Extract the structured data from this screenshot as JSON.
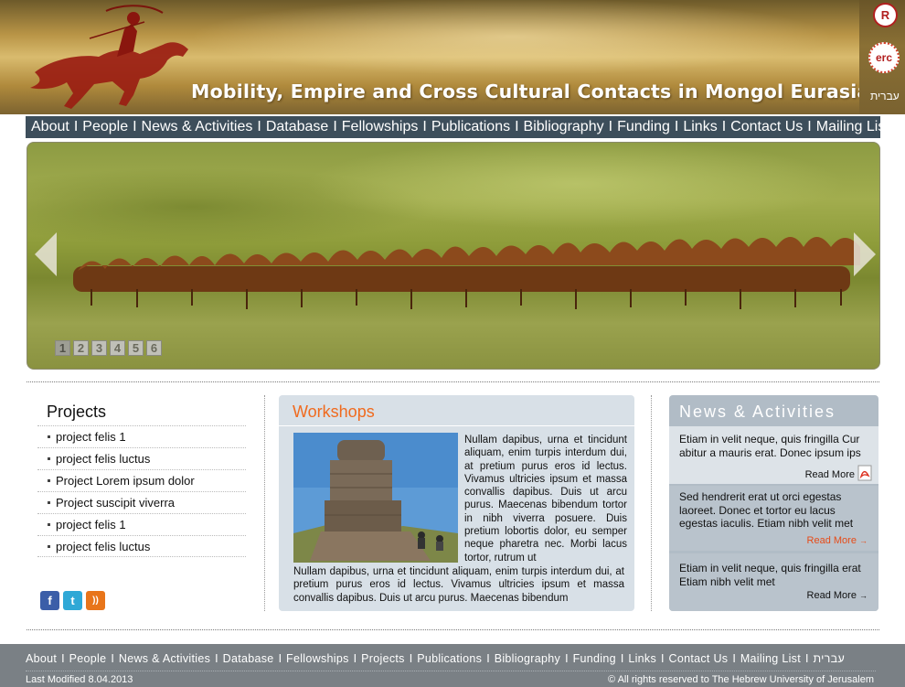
{
  "banner": {
    "site_title": "Mobility, Empire and Cross Cultural Contacts in Mongol Eurasia",
    "logo_small": "R",
    "logo_erc": "erc",
    "hebrew_link": "עברית"
  },
  "topnav": {
    "items": [
      "About",
      "People",
      "News & Activities",
      "Database",
      "Fellowships",
      "Publications",
      "Bibliography",
      "Funding",
      "Links",
      "Contact Us",
      "Mailing List"
    ],
    "separator": "I"
  },
  "slider": {
    "pages": [
      "1",
      "2",
      "3",
      "4",
      "5",
      "6"
    ],
    "active_page": 1
  },
  "projects": {
    "title": "Projects",
    "items": [
      "project felis 1",
      "project felis luctus",
      "Project Lorem ipsum dolor",
      "Project suscipit viverra",
      "project felis 1",
      "project felis luctus"
    ]
  },
  "social": {
    "icons": [
      "facebook-icon",
      "twitter-icon",
      "rss-icon"
    ],
    "facebook_glyph": "f",
    "twitter_glyph": "t",
    "rss_glyph": "))"
  },
  "workshops": {
    "title": "Workshops",
    "text_side": "Nullam dapibus, urna et tincidunt aliquam, enim turpis interdum dui, at pretium purus eros id lectus. Vivamus ultricies ipsum et massa convallis dapibus. Duis ut arcu purus. Maecenas bibendum tortor in nibh viverra posuere. Duis pretium lobortis dolor, eu semper neque pharetra nec. Morbi lacus tortor, rutrum ut",
    "text_bottom": "Nullam dapibus, urna et tincidunt aliquam, enim turpis interdum dui, at pretium purus eros id lectus. Vivamus ultricies ipsum et massa convallis dapibus. Duis ut arcu purus. Maecenas bibendum"
  },
  "news": {
    "title": "News & Activities",
    "items": [
      {
        "text": "Etiam in velit neque, quis fringilla Cur abitur a mauris erat. Donec ipsum ips",
        "more": "Read More"
      },
      {
        "text": "Sed hendrerit erat ut orci egestas laoreet. Donec et tortor eu lacus egestas iaculis. Etiam nibh velit met",
        "more": "Read More"
      },
      {
        "text": "Etiam in velit neque, quis fringilla erat Etiam nibh velit met",
        "more": "Read More"
      }
    ],
    "arrow_glyph": "→"
  },
  "footer": {
    "items": [
      "About",
      "People",
      "News & Activities",
      "Database",
      "Fellowships",
      "Projects",
      "Publications",
      "Bibliography",
      "Funding",
      "Links",
      "Contact Us",
      "Mailing List"
    ],
    "hebrew": "עברית",
    "separator": "I",
    "modified": "Last Modified 8.04.2013",
    "copyright": "© All rights reserved to The Hebrew University of Jerusalem"
  },
  "colors": {
    "nav_bg": "#3d4e5b",
    "accent_orange": "#f06a1e",
    "news_bg": "#b1bcc6",
    "footer_bg": "#7a8085"
  }
}
